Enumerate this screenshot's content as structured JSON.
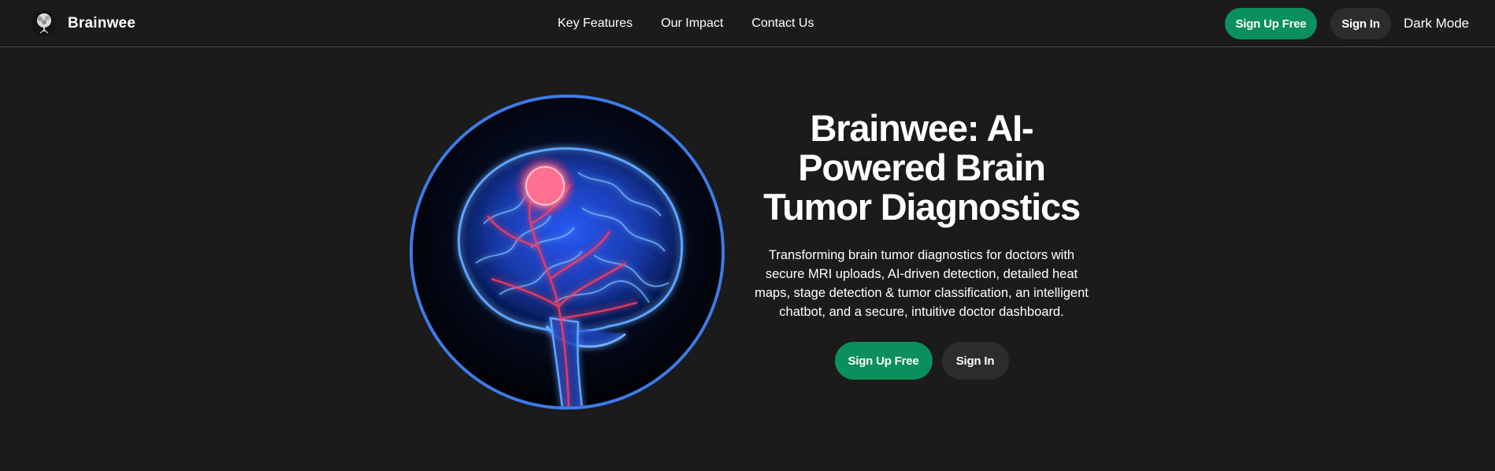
{
  "nav": {
    "brand_name": "Brainwee",
    "links": [
      "Key Features",
      "Our Impact",
      "Contact Us"
    ],
    "signup_label": "Sign Up Free",
    "signin_label": "Sign In",
    "dark_mode_label": "Dark Mode"
  },
  "hero": {
    "title": "Brainwee: AI-Powered Brain Tumor Diagnostics",
    "description": "Transforming brain tumor diagnostics for doctors with secure MRI uploads, AI-driven detection, detailed heat maps, stage detection & tumor classification, an intelligent chatbot, and a secure, intuitive doctor dashboard.",
    "signup_label": "Sign Up Free",
    "signin_label": "Sign In"
  },
  "colors": {
    "background": "#1b1b1b",
    "accent_green": "#0b8f5d",
    "button_dark": "#2c2c2c",
    "image_ring": "#3d7bea"
  },
  "icons": {
    "brand_logo": "tree-brain-logo-icon"
  }
}
